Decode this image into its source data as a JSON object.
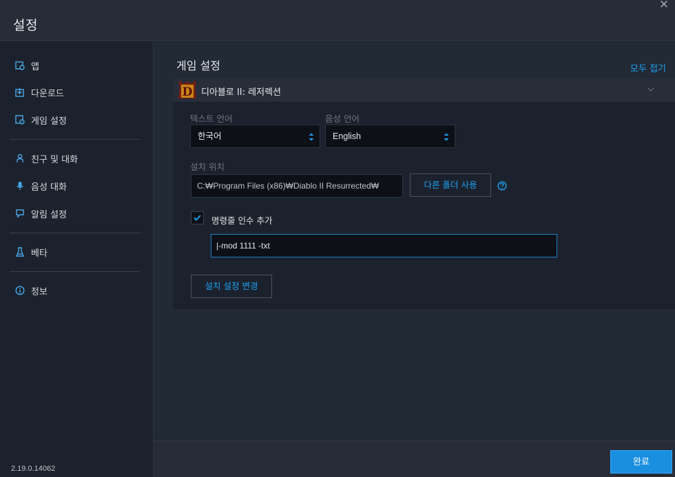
{
  "window": {
    "title": "설정",
    "close_glyph": "✕"
  },
  "sidebar": {
    "items": [
      {
        "label": "앱",
        "icon": "app-settings-icon"
      },
      {
        "label": "다운로드",
        "icon": "download-icon"
      },
      {
        "label": "게임 설정",
        "icon": "game-settings-icon"
      },
      {
        "label": "친구 및 대화",
        "icon": "friends-icon"
      },
      {
        "label": "음성 대화",
        "icon": "microphone-icon"
      },
      {
        "label": "알림 설정",
        "icon": "notification-icon"
      },
      {
        "label": "베타",
        "icon": "beta-flask-icon"
      },
      {
        "label": "정보",
        "icon": "info-icon"
      }
    ],
    "version": "2.19.0.14062"
  },
  "main": {
    "section_title": "게임 설정",
    "collapse_all": "모두 접기",
    "game": {
      "name": "디아블로 II: 레저렉션",
      "logo_letter": "D",
      "text_language_label": "텍스트 언어",
      "text_language_value": "한국어",
      "voice_language_label": "음성 언어",
      "voice_language_value": "English",
      "install_location_label": "설치 위치",
      "install_path": "C:₩Program Files (x86)₩Diablo II Resurrected₩",
      "change_folder_button": "다른 폴더 사용",
      "cmd_args_label": "명령줄 인수 추가",
      "cmd_args_checked": true,
      "cmd_args_value": "|-mod 1111 -txt",
      "install_settings_button": "설치 설정 변경"
    }
  },
  "footer": {
    "done_button": "완료"
  },
  "colors": {
    "accent": "#1da1f2",
    "primary_button": "#1a8fe0",
    "background": "#222a36",
    "sidebar": "#1c222d"
  }
}
